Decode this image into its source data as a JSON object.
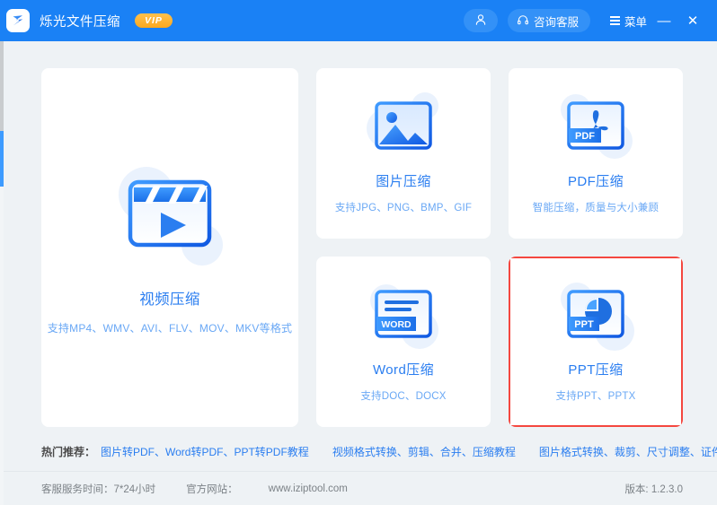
{
  "window": {
    "app_title": "烁光文件压缩",
    "vip_badge": "VIP",
    "logo_icon": "app-logo-z-icon"
  },
  "titlebar": {
    "user_icon": "user-avatar-icon",
    "service_label": "咨询客服",
    "service_icon": "headset-icon",
    "menu_label": "菜单",
    "menu_icon": "hamburger-icon",
    "minimize_label": "—",
    "close_label": "✕"
  },
  "cards": {
    "video": {
      "title": "视频压缩",
      "subtitle": "支持MP4、WMV、AVI、FLV、MOV、MKV等格式",
      "icon": "video-clapper-icon"
    },
    "image": {
      "title": "图片压缩",
      "subtitle": "支持JPG、PNG、BMP、GIF",
      "icon": "image-picture-icon"
    },
    "pdf": {
      "title": "PDF压缩",
      "subtitle": "智能压缩，质量与大小兼顾",
      "icon": "pdf-file-icon",
      "badge_text": "PDF"
    },
    "word": {
      "title": "Word压缩",
      "subtitle": "支持DOC、DOCX",
      "icon": "word-file-icon",
      "badge_text": "WORD"
    },
    "ppt": {
      "title": "PPT压缩",
      "subtitle": "支持PPT、PPTX",
      "icon": "ppt-file-icon",
      "badge_text": "PPT",
      "highlighted": true,
      "highlight_color": "#f4473f"
    }
  },
  "recommend": {
    "label": "热门推荐：",
    "groups": [
      "图片转PDF、Word转PDF、PPT转PDF教程",
      "视频格式转换、剪辑、合并、压缩教程",
      "图片格式转换、裁剪、尺寸调整、证件照大小调整"
    ]
  },
  "footer": {
    "service_hours": "客服服务时间：7*24小时",
    "website_label": "官方网站：",
    "website_url": "www.iziptool.com",
    "version": "版本: 1.2.3.0"
  },
  "colors": {
    "brand_blue": "#1a81f5",
    "accent_orange": "#fba81e",
    "highlight_red": "#f4473f",
    "page_bg": "#eef2f5"
  }
}
